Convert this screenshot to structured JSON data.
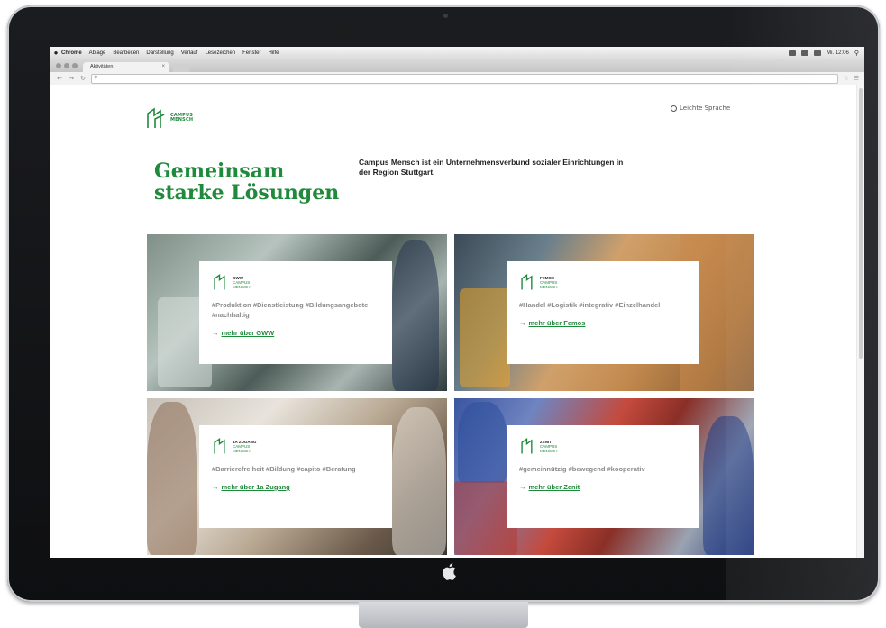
{
  "menubar": {
    "items": [
      "Chrome",
      "Ablage",
      "Bearbeiten",
      "Darstellung",
      "Verlauf",
      "Lesezeichen",
      "Fenster",
      "Hilfe"
    ],
    "clock": "Mi. 12:06"
  },
  "browser": {
    "tab_title": "Aktivitäten",
    "url_placeholder": ""
  },
  "site": {
    "logo_line1": "CAMPUS",
    "logo_line2": "MENSCH",
    "language_link": "Leichte Sprache",
    "headline_line1": "Gemeinsam",
    "headline_line2": "starke Lösungen",
    "intro": "Campus Mensch ist ein Unternehmensverbund sozialer Einrichtungen in der Region Stuttgart."
  },
  "tiles": [
    {
      "brand": "GWW",
      "sub1": "CAMPUS",
      "sub2": "MENSCH",
      "tags": "#Produktion #Dienstleistung #Bildungsangebote #nachhaltig",
      "link": "mehr über GWW"
    },
    {
      "brand": "FEMOS",
      "sub1": "CAMPUS",
      "sub2": "MENSCH",
      "tags": "#Handel #Logistik #integrativ #Einzelhandel",
      "link": "mehr über Femos"
    },
    {
      "brand": "1A ZUGANG",
      "sub1": "CAMPUS",
      "sub2": "MENSCH",
      "tags": "#Barrierefreiheit #Bildung #capito #Beratung",
      "link": "mehr über 1a Zugang"
    },
    {
      "brand": "ZENIT",
      "sub1": "CAMPUS",
      "sub2": "MENSCH",
      "tags": "#gemeinnützig #bewegend #kooperativ",
      "link": "mehr über Zenit"
    }
  ],
  "colors": {
    "brand_green": "#1f8a3b",
    "bezel": "#111214"
  }
}
